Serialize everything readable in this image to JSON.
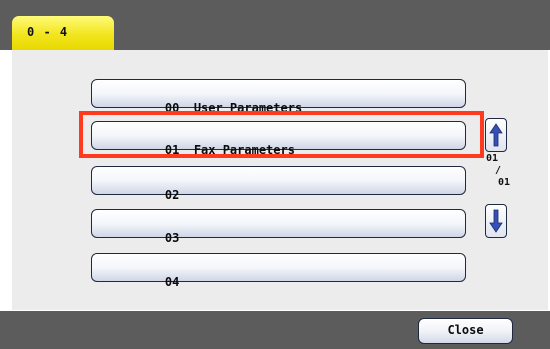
{
  "tab": {
    "label": "0 - 4"
  },
  "params": [
    {
      "code": "00",
      "name": "User Parameters"
    },
    {
      "code": "01",
      "name": "Fax Parameters"
    },
    {
      "code": "02",
      "name": ""
    },
    {
      "code": "03",
      "name": ""
    },
    {
      "code": "04",
      "name": ""
    }
  ],
  "pager": {
    "current": "01",
    "separator": "/",
    "total": "01"
  },
  "footer": {
    "close_label": "Close"
  },
  "colors": {
    "tab": "#f2e51e",
    "highlight": "#ff3a1f",
    "bar": "#5c5c5c",
    "arrow": "#3550b8"
  },
  "icons": {
    "up": "arrow-up-icon",
    "down": "arrow-down-icon"
  }
}
